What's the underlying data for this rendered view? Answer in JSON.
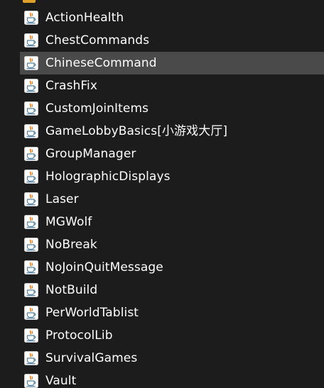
{
  "files": [
    {
      "label": "ActionHealth",
      "icon": "java-file-icon",
      "selected": false
    },
    {
      "label": "ChestCommands",
      "icon": "java-file-icon",
      "selected": false
    },
    {
      "label": "ChineseCommand",
      "icon": "java-file-icon",
      "selected": true
    },
    {
      "label": "CrashFix",
      "icon": "java-file-icon",
      "selected": false
    },
    {
      "label": "CustomJoinItems",
      "icon": "java-file-icon",
      "selected": false
    },
    {
      "label": "GameLobbyBasics[小游戏大厅]",
      "icon": "java-file-icon",
      "selected": false
    },
    {
      "label": "GroupManager",
      "icon": "java-file-icon",
      "selected": false
    },
    {
      "label": "HolographicDisplays",
      "icon": "java-file-icon",
      "selected": false
    },
    {
      "label": "Laser",
      "icon": "java-file-icon",
      "selected": false
    },
    {
      "label": "MGWolf",
      "icon": "java-file-icon",
      "selected": false
    },
    {
      "label": "NoBreak",
      "icon": "java-file-icon",
      "selected": false
    },
    {
      "label": "NoJoinQuitMessage",
      "icon": "java-file-icon",
      "selected": false
    },
    {
      "label": "NotBuild",
      "icon": "java-file-icon",
      "selected": false
    },
    {
      "label": "PerWorldTablist",
      "icon": "java-file-icon",
      "selected": false
    },
    {
      "label": "ProtocolLib",
      "icon": "java-file-icon",
      "selected": false
    },
    {
      "label": "SurvivalGames",
      "icon": "java-file-icon",
      "selected": false
    },
    {
      "label": "Vault",
      "icon": "java-file-icon",
      "selected": false
    }
  ],
  "colors": {
    "background": "#1c1c1c",
    "selected_row": "#4a4a4a",
    "text": "#ffffff",
    "folder_accent": "#e0a12b",
    "java_cup": "#5382a1",
    "java_steam": "#e76f00"
  }
}
